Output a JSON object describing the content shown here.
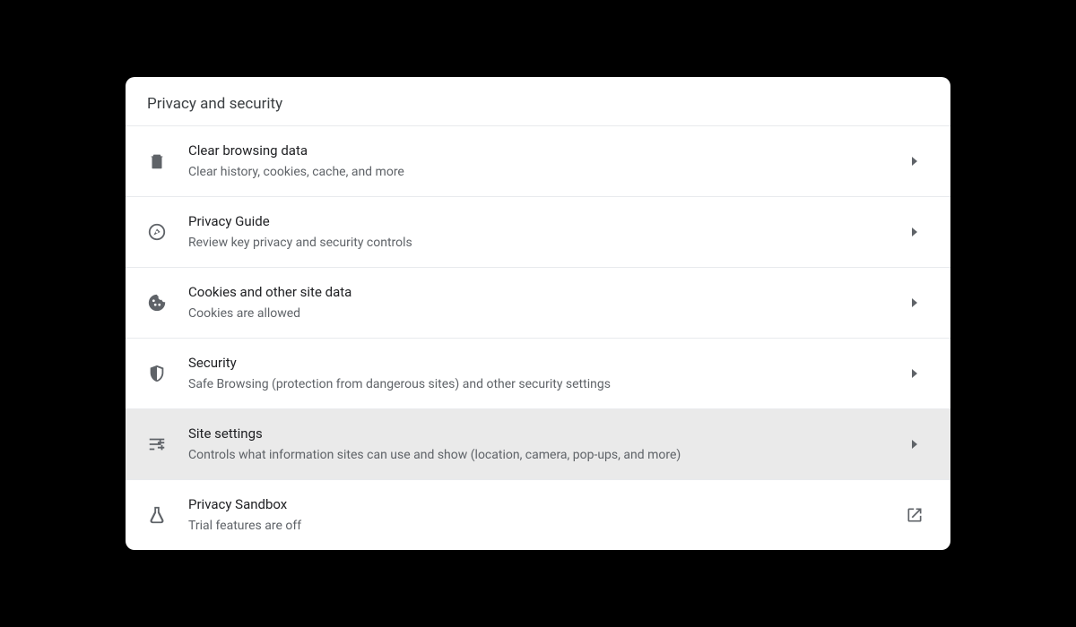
{
  "header": {
    "title": "Privacy and security"
  },
  "items": [
    {
      "icon": "trash-icon",
      "title": "Clear browsing data",
      "subtitle": "Clear history, cookies, cache, and more",
      "action": "arrow",
      "highlighted": false
    },
    {
      "icon": "compass-icon",
      "title": "Privacy Guide",
      "subtitle": "Review key privacy and security controls",
      "action": "arrow",
      "highlighted": false
    },
    {
      "icon": "cookie-icon",
      "title": "Cookies and other site data",
      "subtitle": "Cookies are allowed",
      "action": "arrow",
      "highlighted": false
    },
    {
      "icon": "shield-icon",
      "title": "Security",
      "subtitle": "Safe Browsing (protection from dangerous sites) and other security settings",
      "action": "arrow",
      "highlighted": false
    },
    {
      "icon": "sliders-icon",
      "title": "Site settings",
      "subtitle": "Controls what information sites can use and show (location, camera, pop-ups, and more)",
      "action": "arrow",
      "highlighted": true
    },
    {
      "icon": "flask-icon",
      "title": "Privacy Sandbox",
      "subtitle": "Trial features are off",
      "action": "external",
      "highlighted": false
    }
  ]
}
